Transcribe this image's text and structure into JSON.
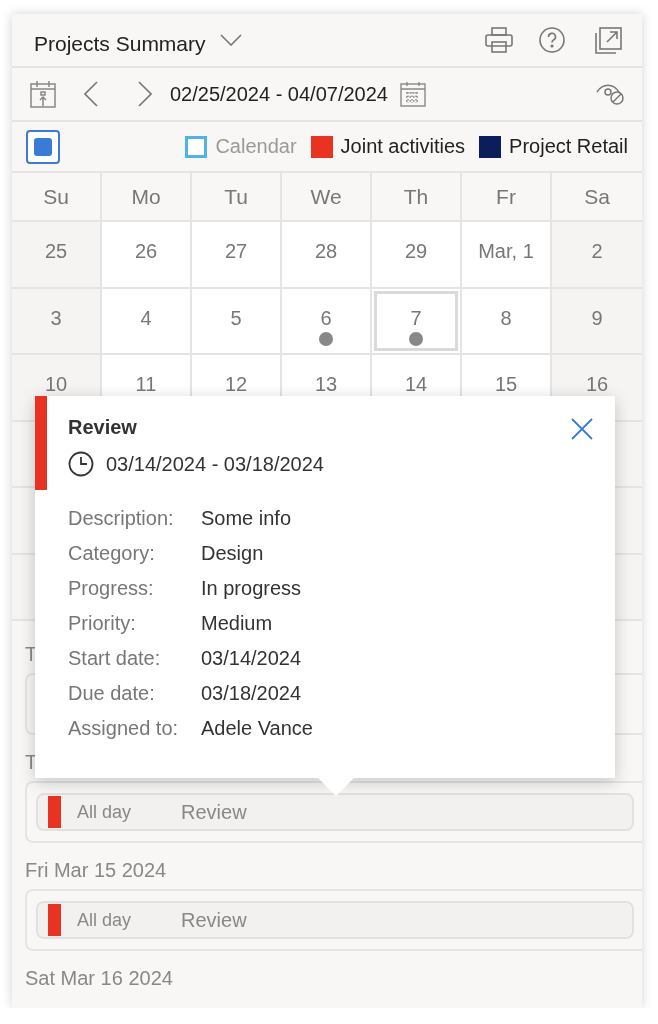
{
  "header": {
    "title": "Projects Summary"
  },
  "toolbar": {
    "date_range": "02/25/2024 - 04/07/2024"
  },
  "legend": {
    "select_all": {
      "checked": true
    },
    "items": [
      {
        "label": "Calendar",
        "color": "#4fb3e8",
        "enabled": false
      },
      {
        "label": "Joint activities",
        "color": "#e83323",
        "enabled": true
      },
      {
        "label": "Project Retail",
        "color": "#0b1e5b",
        "enabled": true
      }
    ]
  },
  "weekdays": [
    "Su",
    "Mo",
    "Tu",
    "We",
    "Th",
    "Fr",
    "Sa"
  ],
  "weeks": [
    [
      {
        "day": "25",
        "selected": false,
        "has_events": false
      },
      {
        "day": "26",
        "selected": false,
        "has_events": false
      },
      {
        "day": "27",
        "selected": false,
        "has_events": false
      },
      {
        "day": "28",
        "selected": false,
        "has_events": false
      },
      {
        "day": "29",
        "selected": false,
        "has_events": false
      },
      {
        "day": "Mar, 1",
        "selected": false,
        "has_events": false
      },
      {
        "day": "2",
        "selected": false,
        "has_events": false
      }
    ],
    [
      {
        "day": "3",
        "selected": false,
        "has_events": false
      },
      {
        "day": "4",
        "selected": false,
        "has_events": false
      },
      {
        "day": "5",
        "selected": false,
        "has_events": false
      },
      {
        "day": "6",
        "selected": false,
        "has_events": true
      },
      {
        "day": "7",
        "selected": true,
        "has_events": true
      },
      {
        "day": "8",
        "selected": false,
        "has_events": false
      },
      {
        "day": "9",
        "selected": false,
        "has_events": false
      }
    ],
    [
      {
        "day": "10",
        "selected": false
      },
      {
        "day": "11",
        "selected": false
      },
      {
        "day": "12",
        "selected": false
      },
      {
        "day": "13",
        "selected": false
      },
      {
        "day": "14",
        "selected": false
      },
      {
        "day": "15",
        "selected": false
      },
      {
        "day": "16",
        "selected": false
      }
    ]
  ],
  "agenda": [
    {
      "date": "T"
    },
    {
      "date": "T",
      "events": [
        {
          "time": "All day",
          "title": "Review",
          "color": "#e83323"
        }
      ]
    },
    {
      "date": "Fri Mar 15 2024",
      "events": [
        {
          "time": "All day",
          "title": "Review",
          "color": "#e83323"
        }
      ]
    },
    {
      "date": "Sat Mar 16 2024"
    }
  ],
  "popup": {
    "title": "Review",
    "color": "#e83323",
    "range": "03/14/2024 - 03/18/2024",
    "details": [
      {
        "label": "Description:",
        "value": "Some info"
      },
      {
        "label": "Category:",
        "value": "Design"
      },
      {
        "label": "Progress:",
        "value": "In progress"
      },
      {
        "label": "Priority:",
        "value": "Medium"
      },
      {
        "label": "Start date:",
        "value": "03/14/2024"
      },
      {
        "label": "Due date:",
        "value": "03/18/2024"
      },
      {
        "label": "Assigned to:",
        "value": "Adele Vance"
      }
    ]
  }
}
